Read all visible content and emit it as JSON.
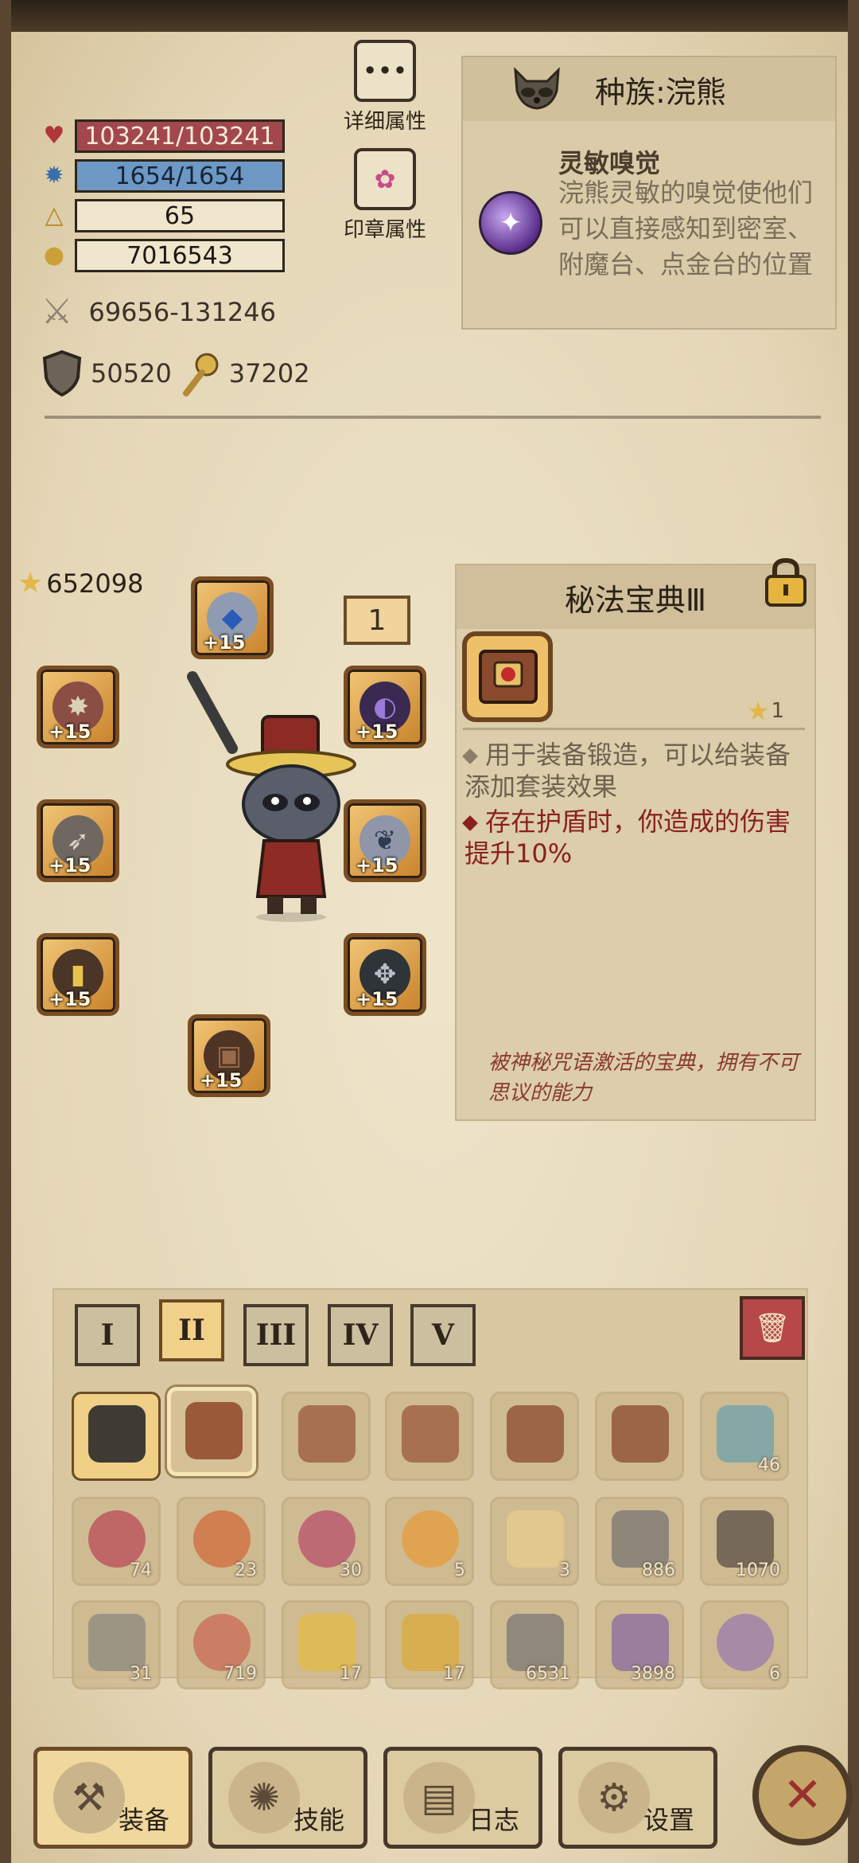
{
  "stats": {
    "hp": "103241/103241",
    "mp": "1654/1654",
    "level": "65",
    "gold": "7016543",
    "attack": "69656-131246",
    "defense": "50520",
    "magic": "37202"
  },
  "side_buttons": {
    "detail_label": "详细属性",
    "seal_label": "印章属性"
  },
  "race": {
    "title": "种族:浣熊",
    "skill_name": "灵敏嗅觉",
    "skill_desc": "浣熊灵敏的嗅觉使他们可以直接感知到密室、附魔台、点金台的位置"
  },
  "equipment": {
    "star_score": "652098",
    "slot_count_box": "1",
    "enhance_label": "+15"
  },
  "item": {
    "title": "秘法宝典Ⅲ",
    "stars": "1",
    "desc1": "用于装备锻造，可以给装备添加套装效果",
    "desc2": "存在护盾时，你造成的伤害提升10%",
    "lore": "被神秘咒语激活的宝典，拥有不可思议的能力"
  },
  "inventory": {
    "tabs": [
      "I",
      "II",
      "III",
      "IV",
      "V"
    ],
    "active_tab": "II",
    "row1": [
      "",
      "",
      "",
      "",
      "",
      "",
      "46"
    ],
    "row2": [
      "74",
      "23",
      "30",
      "5",
      "3",
      "886",
      "1070"
    ],
    "row3": [
      "31",
      "719",
      "17",
      "17",
      "6531",
      "3898",
      "6"
    ]
  },
  "nav": {
    "equip": "装备",
    "skill": "技能",
    "log": "日志",
    "settings": "设置"
  },
  "colors": {
    "hp_bar": "#a2484c",
    "mp_bar": "#6d98c4",
    "highlight_red": "#8a2020"
  }
}
